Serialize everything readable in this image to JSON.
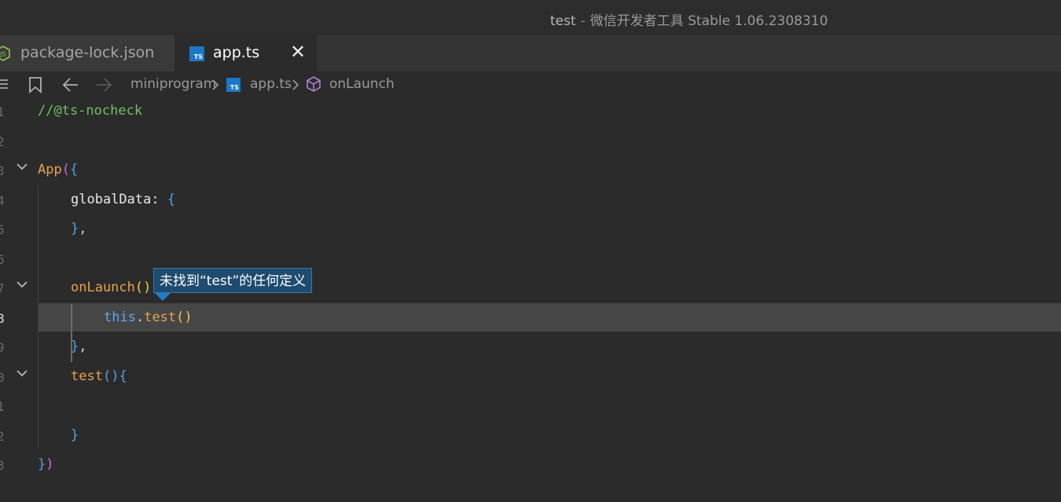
{
  "window": {
    "project": "test",
    "separator": "-",
    "app_name": "微信开发者工具 Stable 1.06.2308310"
  },
  "tabs": [
    {
      "label": "package-lock.json",
      "icon": "nodejs-icon",
      "active": false
    },
    {
      "label": "app.ts",
      "icon": "typescript-icon",
      "active": true,
      "close": "✕"
    }
  ],
  "breadcrumb": {
    "folder": "miniprogram",
    "file": "app.ts",
    "symbol": "onLaunch"
  },
  "editor": {
    "line_numbers": [
      "1",
      "2",
      "3",
      "4",
      "5",
      "6",
      "7",
      "8",
      "9",
      "0",
      "1",
      "2",
      "3"
    ],
    "active_line": "8",
    "tooltip": "未找到“test”的任何定义",
    "lines": {
      "l1_comment": "//@ts-nocheck",
      "l3_fn": "App",
      "l3_paren": "(",
      "l3_brace": "{",
      "l4_prop": "globalData: ",
      "l4_brace": "{",
      "l5_brace": "}",
      "l5_comma": ",",
      "l7_fn": "onLaunch",
      "l7_parens": "()",
      "l8_this": "this",
      "l8_dot": ".",
      "l8_fn": "test",
      "l8_parens": "()",
      "l9_brace": "}",
      "l9_comma": ",",
      "l10_fn": "test",
      "l10_parens": "()",
      "l10_brace": "{",
      "l12_brace": "}",
      "l13_brace": "}",
      "l13_paren": ")"
    }
  },
  "colors": {
    "comment": "#6ec15f",
    "function": "#e6a24a",
    "keyword_this": "#5aa9ef",
    "tooltip_bg": "#1e4b6e"
  }
}
